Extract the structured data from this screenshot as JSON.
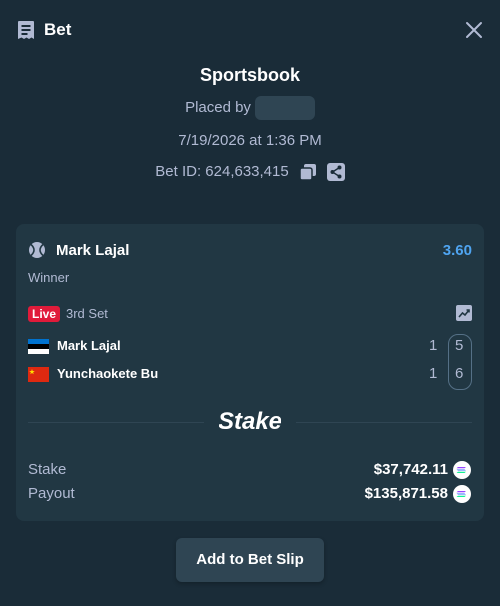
{
  "header": {
    "title": "Bet",
    "icon": "receipt-icon",
    "close_icon": "close-icon"
  },
  "bet": {
    "source": "Sportsbook",
    "placed_by_label": "Placed by",
    "datetime": "7/19/2026 at 1:36 PM",
    "bet_id_label": "Bet ID: 624,633,415",
    "copy_icon": "copy-icon",
    "share_icon": "share-icon"
  },
  "selection": {
    "player": "Mark Lajal",
    "odds": "3.60",
    "market": "Winner",
    "live_label": "Live",
    "set_label": "3rd Set",
    "teams": [
      {
        "name": "Mark Lajal",
        "flag": "estonia-flag",
        "score_1": "1",
        "score_2": "5"
      },
      {
        "name": "Yunchaokete Bu",
        "flag": "china-flag",
        "score_1": "1",
        "score_2": "6"
      }
    ]
  },
  "brand": {
    "logo_text": "Stake"
  },
  "amounts": {
    "stake_label": "Stake",
    "stake_value": "$37,742.11",
    "payout_label": "Payout",
    "payout_value": "$135,871.58",
    "currency_icon": "solana-icon"
  },
  "actions": {
    "add_to_bet_slip": "Add to Bet Slip"
  },
  "colors": {
    "background": "#1a2c38",
    "card": "#213743",
    "odds": "#4fa4f0",
    "live": "#e01b3a",
    "button": "#2f4553"
  }
}
